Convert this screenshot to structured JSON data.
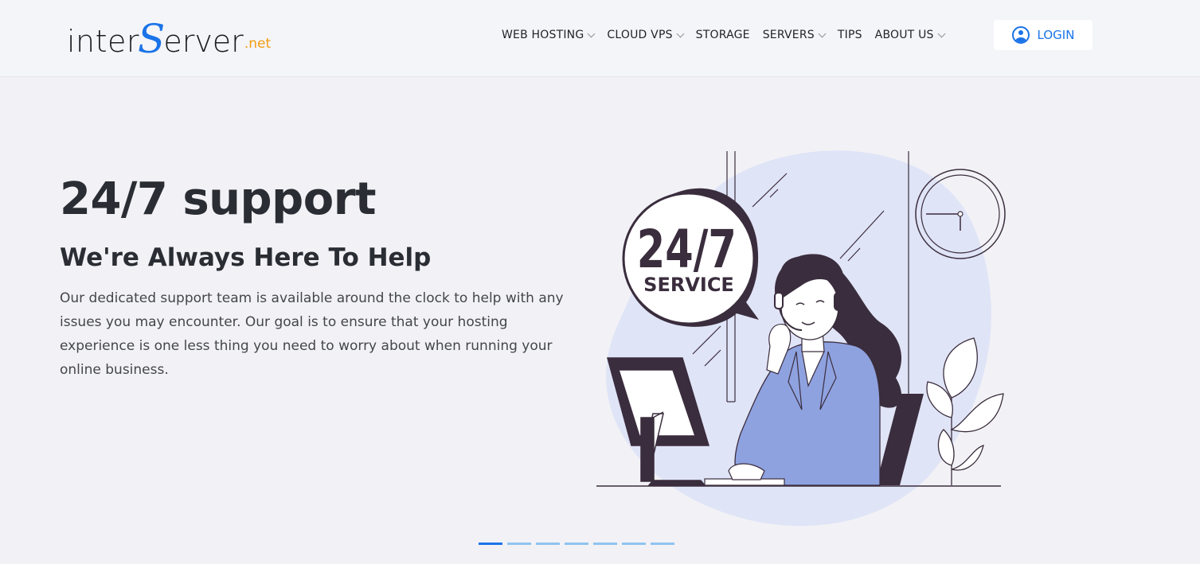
{
  "brand": {
    "inter": "inter",
    "s": "S",
    "erver": "erver",
    "net": ".net"
  },
  "nav": {
    "items": [
      {
        "label": "WEB HOSTING",
        "has_dropdown": true
      },
      {
        "label": "CLOUD VPS",
        "has_dropdown": true
      },
      {
        "label": "STORAGE",
        "has_dropdown": false
      },
      {
        "label": "SERVERS",
        "has_dropdown": true
      },
      {
        "label": "TIPS",
        "has_dropdown": false
      },
      {
        "label": "ABOUT US",
        "has_dropdown": true
      }
    ],
    "login_label": "LOGIN"
  },
  "hero": {
    "title": "24/7 support",
    "subtitle": "We're Always Here To Help",
    "description": "Our dedicated support team is available around the clock to help with any issues you may encounter. Our goal is to ensure that your hosting experience is one less thing you need to worry about when running your online business."
  },
  "illustration": {
    "bubble_big": "24/7",
    "bubble_small": "SERVICE"
  },
  "carousel": {
    "slide_count": 7,
    "active_index": 0
  },
  "colors": {
    "accent": "#1a73e8",
    "brand_orange": "#f39c12",
    "illustration_blob": "#e0e4f7",
    "jacket": "#8fa2e0",
    "dark": "#3a2d3d"
  }
}
